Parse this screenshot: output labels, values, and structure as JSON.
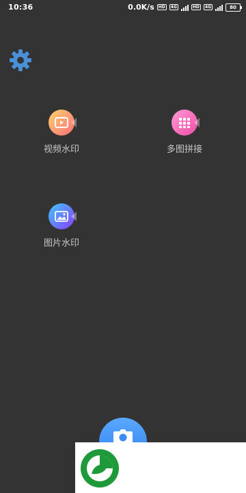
{
  "status_bar": {
    "time": "10:36",
    "net_speed": "0.0K/s",
    "hd_badge": "HD",
    "network_badge": "4G",
    "battery_level": "80"
  },
  "toolbar": {
    "settings_icon": "gear-icon"
  },
  "features": [
    {
      "label": "视频水印",
      "icon": "video-play-icon",
      "color_start": "#ffd36b",
      "color_end": "#ff6e7a"
    },
    {
      "label": "多图拼接",
      "icon": "grid-icon",
      "color_start": "#ff9bd6",
      "color_end": "#f04ba4"
    },
    {
      "label": "图片水印",
      "icon": "image-icon",
      "color_start": "#3ec8ff",
      "color_end": "#8a3dff"
    }
  ],
  "camera_button": {
    "icon": "camera-icon",
    "color": "#3d8cf5"
  },
  "ad": {
    "logo_icon": "green-leaf-logo-icon"
  },
  "colors": {
    "background": "#333333",
    "label_text": "#c8c8c8",
    "settings_icon": "#4a90d9"
  }
}
